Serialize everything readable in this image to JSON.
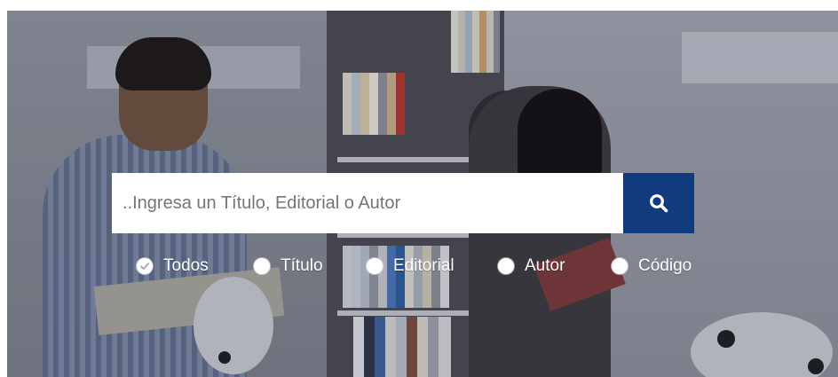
{
  "search": {
    "placeholder": "..Ingresa un Título, Editorial o Autor"
  },
  "filters": [
    {
      "label": "Todos",
      "selected": true
    },
    {
      "label": "Título",
      "selected": false
    },
    {
      "label": "Editorial",
      "selected": false
    },
    {
      "label": "Autor",
      "selected": false
    },
    {
      "label": "Código",
      "selected": false
    }
  ],
  "icons": {
    "search": "search-icon",
    "check": "check-icon"
  },
  "colors": {
    "search_button": "#123a7f",
    "radio": "#ffffff",
    "text": "#ffffff"
  }
}
